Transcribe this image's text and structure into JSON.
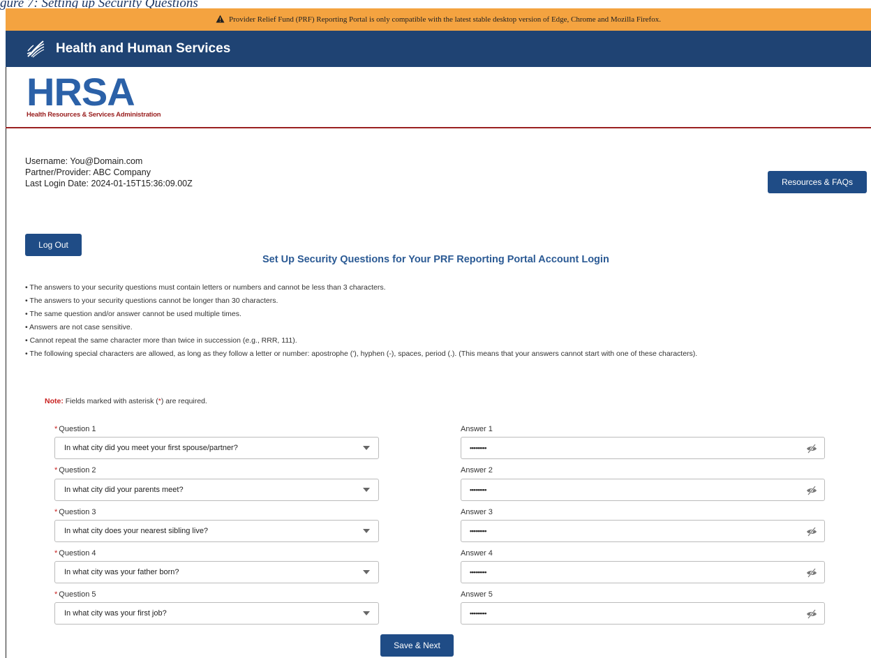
{
  "caption": "gure 7: Setting up Security Questions",
  "banner": {
    "icon": "warning-icon",
    "text": "Provider Relief Fund (PRF) Reporting Portal is only compatible with the latest stable desktop version of Edge, Chrome and Mozilla Firefox."
  },
  "header": {
    "logo_icon": "hhs-eagle-icon",
    "title": "Health and Human Services"
  },
  "brand": {
    "logo_text": "HRSA",
    "subtitle": "Health Resources & Services Administration"
  },
  "user": {
    "username": "Username: You@Domain.com",
    "provider": "Partner/Provider: ABC Company",
    "last_login": "Last Login Date: 2024-01-15T15:36:09.00Z"
  },
  "buttons": {
    "resources": "Resources & FAQs",
    "logout": "Log Out",
    "save_next": "Save & Next"
  },
  "page_heading": "Set Up Security Questions for Your PRF Reporting Portal Account Login",
  "rules": [
    "• The answers to your security questions must contain letters or numbers and cannot be less than 3 characters.",
    "• The answers to your security questions cannot be longer than 30 characters.",
    "• The same question and/or answer cannot be used multiple times.",
    "• Answers are not case sensitive.",
    "• Cannot repeat the same character more than twice in succession (e.g., RRR, 111).",
    "• The following special characters are allowed, as long as they follow a letter or number: apostrophe ('), hyphen (-), spaces, period (.). (This means that your answers cannot start with one of these characters)."
  ],
  "note": {
    "label": "Note:",
    "text_before": " Fields marked with asterisk (",
    "asterisk": "*",
    "text_after": ") are required."
  },
  "questions": [
    {
      "label": "Question 1",
      "selected": "In what city did you meet your first spouse/partner?",
      "answer_label": "Answer 1",
      "answer_value": "•••••••••"
    },
    {
      "label": "Question 2",
      "selected": "In what city did your parents meet?",
      "answer_label": "Answer 2",
      "answer_value": "•••••••••"
    },
    {
      "label": "Question 3",
      "selected": "In what city does your nearest sibling live?",
      "answer_label": "Answer 3",
      "answer_value": "•••••••••"
    },
    {
      "label": "Question 4",
      "selected": "In what city was your father born?",
      "answer_label": "Answer 4",
      "answer_value": "•••••••••"
    },
    {
      "label": "Question 5",
      "selected": "In what city was your first job?",
      "answer_label": "Answer 5",
      "answer_value": "•••••••••"
    }
  ],
  "colors": {
    "banner": "#f4a340",
    "header": "#1f4373",
    "button": "#1f4c86",
    "heading": "#2b5a94",
    "required": "#c8201f",
    "hrsa_blue": "#2b61a8",
    "hrsa_red": "#9a2020"
  }
}
